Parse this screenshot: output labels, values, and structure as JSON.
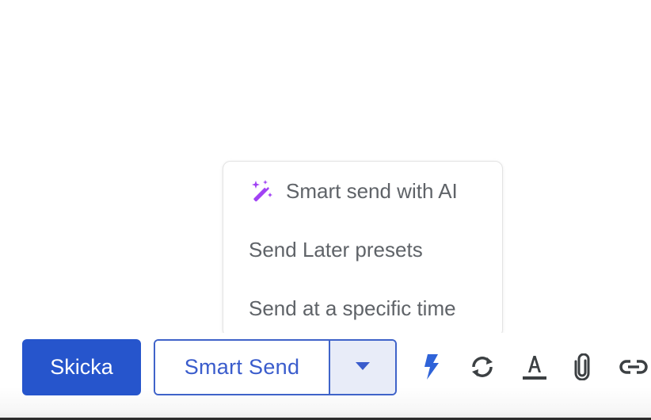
{
  "menu": {
    "items": [
      {
        "label": "Smart send with AI",
        "icon": "magic-wand-sparkle-icon",
        "icon_color": "#a142f4"
      },
      {
        "label": "Send Later presets"
      },
      {
        "label": "Send at a specific time"
      }
    ]
  },
  "toolbar": {
    "send_label": "Skicka",
    "smart_send_label": "Smart Send",
    "dropdown_icon": "caret-down-icon",
    "icons": [
      "lightning-bolt-icon",
      "sync-icon",
      "text-format-icon",
      "paperclip-icon",
      "link-icon"
    ]
  },
  "colors": {
    "primary": "#2655cc",
    "accent_border": "#3f63c9",
    "menu_text": "#5f6368",
    "ai_purple": "#a142f4",
    "icon_dark": "#3c4043"
  }
}
